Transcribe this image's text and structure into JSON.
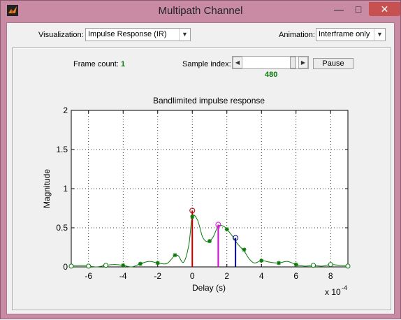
{
  "window": {
    "title": "Multipath Channel",
    "controls": {
      "minimize": "—",
      "maximize": "□",
      "close": "✕"
    },
    "app_icon": "matlab-icon"
  },
  "toolbar": {
    "visualization_label": "Visualization:",
    "visualization_value": "Impulse Response (IR)",
    "animation_label": "Animation:",
    "animation_value": "Interframe only"
  },
  "status": {
    "frame_count_label": "Frame count:",
    "frame_count_value": "1",
    "sample_index_label": "Sample index:",
    "sample_index_value": "480",
    "pause_label": "Pause"
  },
  "colors": {
    "window_frame": "#c98ba4",
    "curve": "#0a7a0a",
    "path_1": "#c00000",
    "path_2": "#e000e0",
    "path_3": "#000090"
  },
  "chart_data": {
    "type": "line",
    "title": "Bandlimited impulse response",
    "xlabel": "Delay (s)",
    "ylabel": "Magnitude",
    "x_exponent_label": "x 10",
    "x_exponent_power": "-4",
    "xlim": [
      -7,
      9
    ],
    "ylim": [
      0,
      2
    ],
    "xticks": [
      -6,
      -4,
      -2,
      0,
      2,
      4,
      6,
      8
    ],
    "xtick_labels": [
      "-6",
      "-4",
      "-2",
      "0",
      "2",
      "4",
      "6",
      "8"
    ],
    "yticks": [
      0,
      0.5,
      1,
      1.5,
      2
    ],
    "ytick_labels": [
      "0",
      "0.5",
      "1",
      "1.5",
      "2"
    ],
    "grid": true,
    "curve": {
      "x": [
        -7,
        -6.5,
        -6,
        -5.5,
        -5,
        -4.5,
        -4,
        -3.5,
        -3,
        -2.5,
        -2,
        -1.5,
        -1.2,
        -1,
        -0.8,
        -0.5,
        -0.2,
        0,
        0.3,
        0.6,
        0.9,
        1.2,
        1.5,
        1.8,
        2.0,
        2.3,
        2.6,
        3.0,
        3.3,
        3.6,
        4.0,
        4.5,
        5.0,
        5.5,
        6.0,
        6.5,
        7.0,
        7.5,
        8.0,
        8.5,
        9.0
      ],
      "y": [
        0.01,
        0.02,
        0.01,
        0.0,
        0.02,
        0.03,
        0.02,
        0.0,
        0.04,
        0.07,
        0.05,
        0.04,
        0.1,
        0.15,
        0.14,
        0.06,
        0.28,
        0.64,
        0.6,
        0.38,
        0.32,
        0.38,
        0.52,
        0.52,
        0.48,
        0.4,
        0.3,
        0.2,
        0.1,
        0.05,
        0.08,
        0.06,
        0.05,
        0.07,
        0.03,
        0.01,
        0.02,
        0.01,
        0.03,
        0.02,
        0.01
      ]
    },
    "samples": {
      "x": [
        -7,
        -6,
        -5,
        -4,
        -3,
        -2,
        -1,
        0,
        1,
        2,
        3,
        4,
        5,
        6,
        7,
        8,
        9
      ],
      "y": [
        0.01,
        0.01,
        0.02,
        0.02,
        0.04,
        0.05,
        0.15,
        0.64,
        0.33,
        0.48,
        0.22,
        0.08,
        0.05,
        0.03,
        0.02,
        0.03,
        0.01
      ],
      "open": [
        true,
        true,
        true,
        false,
        false,
        false,
        false,
        false,
        false,
        false,
        false,
        false,
        false,
        false,
        true,
        true,
        true
      ]
    },
    "paths": [
      {
        "delay": 0.0,
        "gain": 0.72,
        "color": "#c00000"
      },
      {
        "delay": 1.5,
        "gain": 0.54,
        "color": "#e000e0"
      },
      {
        "delay": 2.5,
        "gain": 0.37,
        "color": "#000090"
      }
    ]
  }
}
